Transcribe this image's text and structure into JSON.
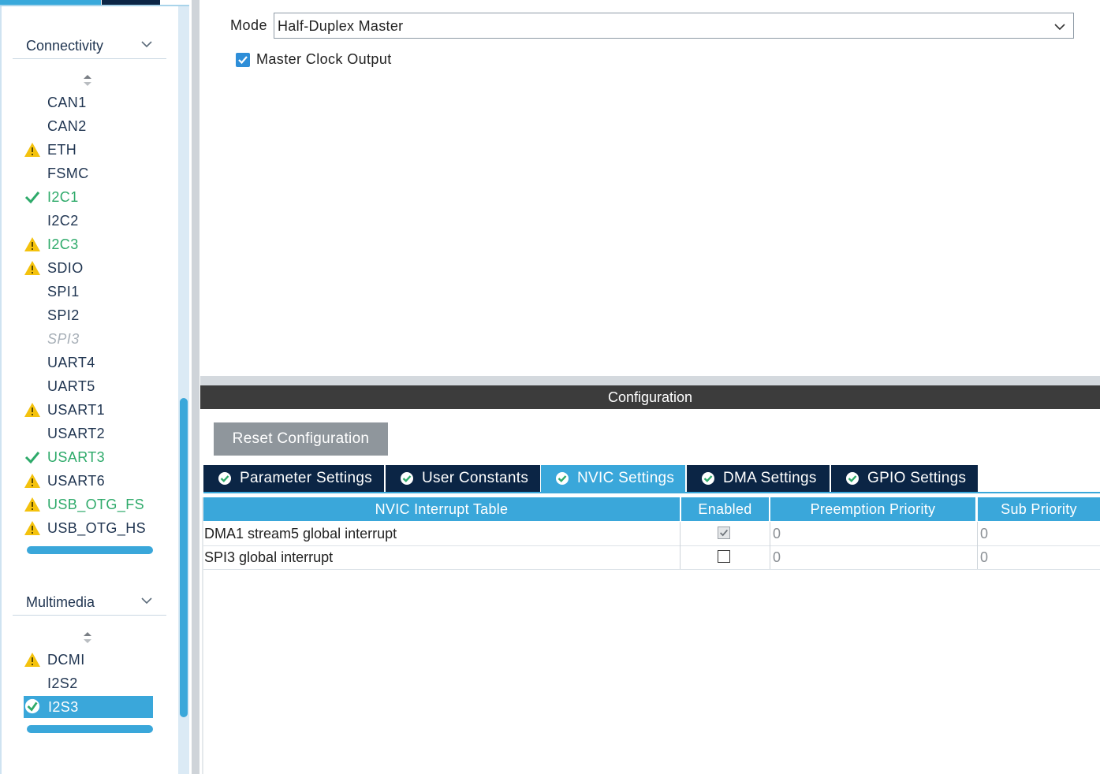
{
  "sidebar": {
    "categories": [
      {
        "label": "Connectivity",
        "items": [
          {
            "label": "CAN1",
            "status": "none"
          },
          {
            "label": "CAN2",
            "status": "none"
          },
          {
            "label": "ETH",
            "status": "warning"
          },
          {
            "label": "FSMC",
            "status": "none"
          },
          {
            "label": "I2C1",
            "status": "ok"
          },
          {
            "label": "I2C2",
            "status": "none"
          },
          {
            "label": "I2C3",
            "status": "warning"
          },
          {
            "label": "SDIO",
            "status": "warning"
          },
          {
            "label": "SPI1",
            "status": "none"
          },
          {
            "label": "SPI2",
            "status": "none"
          },
          {
            "label": "SPI3",
            "status": "disabled"
          },
          {
            "label": "UART4",
            "status": "none"
          },
          {
            "label": "UART5",
            "status": "none"
          },
          {
            "label": "USART1",
            "status": "warning"
          },
          {
            "label": "USART2",
            "status": "none"
          },
          {
            "label": "USART3",
            "status": "ok"
          },
          {
            "label": "USART6",
            "status": "warning"
          },
          {
            "label": "USB_OTG_FS",
            "status": "warning"
          },
          {
            "label": "USB_OTG_HS",
            "status": "warning"
          }
        ]
      },
      {
        "label": "Multimedia",
        "items": [
          {
            "label": "DCMI",
            "status": "warning"
          },
          {
            "label": "I2S2",
            "status": "none"
          },
          {
            "label": "I2S3",
            "status": "ok-selected"
          }
        ]
      }
    ]
  },
  "mode": {
    "label": "Mode",
    "value": "Half-Duplex Master",
    "master_clock_output_label": "Master Clock Output",
    "master_clock_output_checked": true
  },
  "configuration": {
    "header": "Configuration",
    "reset_button": "Reset Configuration",
    "tabs": [
      {
        "label": "Parameter Settings",
        "active": false
      },
      {
        "label": "User Constants",
        "active": false
      },
      {
        "label": "NVIC Settings",
        "active": true
      },
      {
        "label": "DMA Settings",
        "active": false
      },
      {
        "label": "GPIO Settings",
        "active": false
      }
    ],
    "nvic_table": {
      "columns": [
        "NVIC Interrupt Table",
        "Enabled",
        "Preemption Priority",
        "Sub Priority"
      ],
      "rows": [
        {
          "name": "DMA1 stream5 global interrupt",
          "enabled": true,
          "preemption": "0",
          "sub": "0"
        },
        {
          "name": "SPI3 global interrupt",
          "enabled": false,
          "preemption": "0",
          "sub": "0"
        }
      ]
    }
  },
  "colors": {
    "accent": "#3aa7da",
    "navy": "#0b2545",
    "warning": "#f4c20d",
    "ok": "#2eaa6a",
    "header_dark": "#3c3c3c"
  }
}
